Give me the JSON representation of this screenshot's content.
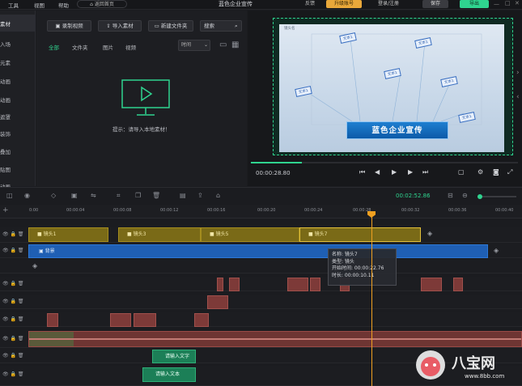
{
  "menu": {
    "items": [
      "工具",
      "视图",
      "帮助"
    ],
    "home": "返回首页"
  },
  "project_title": "蓝色企业宣传",
  "top_right": {
    "feedback": "反馈",
    "upgrade": "升级账号",
    "login": "登录/注册",
    "save": "保存",
    "export": "导出"
  },
  "leftnav": {
    "items": [
      "素材",
      "入场",
      "元素",
      "动画",
      "动画",
      "遮罩",
      "装饰",
      "叠加",
      "贴图",
      "动画"
    ]
  },
  "media": {
    "record_btn": "录制视频",
    "import_btn": "导入素材",
    "newfolder_btn": "新建文件夹",
    "search_placeholder": "搜索",
    "filters": [
      "全部",
      "文件夹",
      "图片",
      "视频"
    ],
    "sort": "时间",
    "hint": "提示：请导入本地素材！"
  },
  "preview": {
    "current_time": "00:00:28.80",
    "tags": [
      "文本1",
      "文本1",
      "文本1",
      "文本1",
      "文本1",
      "文本1"
    ],
    "banner": "蓝色企业宣传",
    "placeholder": "镜头名"
  },
  "timeline": {
    "total": "00:02:52.86",
    "ticks": [
      "0:00",
      "00:00:04",
      "00:00:08",
      "00:00:12",
      "00:00:16",
      "00:00:20",
      "00:00:24",
      "00:00:28",
      "00:00:32",
      "00:00:36",
      "00:00:40"
    ],
    "shots": [
      "镜头1",
      "镜头3",
      "镜头5",
      "镜头7"
    ],
    "background": "背景",
    "text_clip": "请输入文字",
    "text_clip2": "请输入文本",
    "tooltip": {
      "name": "名称: 镜头7",
      "type": "类型: 镜头",
      "start": "开始时间: 00:00:22.76",
      "duration": "时长: 00:00:10.11"
    }
  },
  "watermark": {
    "text": "八宝网",
    "url": "www.8bb.com"
  },
  "colors": {
    "accent": "#2fd48f",
    "shot": "#7a6a17",
    "bg_track": "#1f5fb4",
    "audio": "#7d3a38",
    "playhead": "#f0a020"
  }
}
